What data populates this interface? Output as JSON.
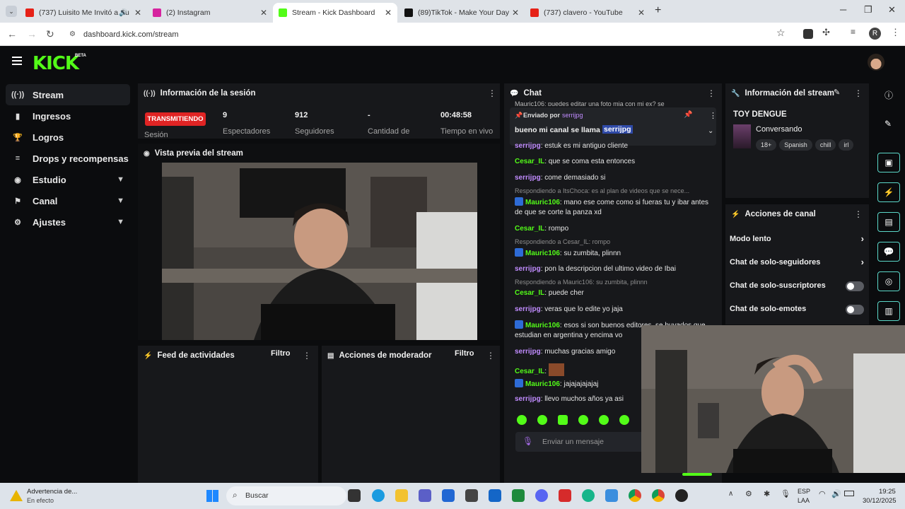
{
  "browser": {
    "tabs": [
      {
        "title": "(737) Luisito Me Invitó a Su",
        "color": "#e62117"
      },
      {
        "title": "(2) Instagram",
        "color": "#d6249f"
      },
      {
        "title": "Stream - Kick Dashboard",
        "color": "#53fc18"
      },
      {
        "title": "(89)TikTok - Make Your Day",
        "color": "#111111"
      },
      {
        "title": "(737) clavero - YouTube",
        "color": "#e62117"
      }
    ],
    "url": "dashboard.kick.com/stream",
    "profile_initial": "R"
  },
  "kick": {
    "logo": "KICK",
    "beta": "BETA"
  },
  "sidebar": {
    "items": [
      {
        "label": "Stream",
        "icon": "broadcast-icon",
        "glyph": "((·))"
      },
      {
        "label": "Ingresos",
        "icon": "chart-icon",
        "glyph": "▮"
      },
      {
        "label": "Logros",
        "icon": "trophy-icon",
        "glyph": "🏆"
      },
      {
        "label": "Drops y recompensas",
        "icon": "drops-icon",
        "glyph": "≡"
      },
      {
        "label": "Estudio",
        "icon": "studio-icon",
        "glyph": "◉"
      },
      {
        "label": "Canal",
        "icon": "channel-icon",
        "glyph": "⚑"
      },
      {
        "label": "Ajustes",
        "icon": "gear-icon",
        "glyph": "⚙"
      }
    ]
  },
  "session": {
    "title": "Información de la sesión",
    "status": "TRANSMITIENDO",
    "status_label": "Sesión",
    "spectators_value": "9",
    "spectators_label": "Espectadores",
    "followers_value": "912",
    "followers_label": "Seguidores",
    "amount_value": "-",
    "amount_label": "Cantidad de",
    "time_value": "00:48:58",
    "time_label": "Tiempo en vivo"
  },
  "preview": {
    "title": "Vista previa del stream"
  },
  "feed": {
    "title": "Feed de actividades",
    "filter": "Filtro"
  },
  "mod": {
    "title": "Acciones de moderador",
    "filter": "Filtro"
  },
  "chat": {
    "title": "Chat",
    "pinned": {
      "sent_by": "Enviado por",
      "user": "serrijpg",
      "text": "bueno mi canal se llama",
      "highlight": "serrijpg"
    },
    "partial_top": "Mauric106: puedes editar una foto mia con mi ex? se",
    "messages": [
      {
        "user": "serrijpg",
        "text": ": estuk es mi antiguo cliente"
      },
      {
        "user": "Cesar_IL",
        "text": ": que se coma esta entonces"
      },
      {
        "user": "serrijpg",
        "text": ": come demasiado si"
      },
      {
        "reply": "Respondiendo a ItsChoca: es al plan de videos que se nece..."
      },
      {
        "user": "Mauric106",
        "text": ": mano ese come como si fueras tu y ibar antes de que se corte la panza xd"
      },
      {
        "user": "Cesar_IL",
        "text": ": rompo"
      },
      {
        "reply": "Respondiendo a Cesar_IL: rompo"
      },
      {
        "user": "Mauric106",
        "text": ": su zumbita, plinnn"
      },
      {
        "user": "serrijpg",
        "text": ": pon la descripcion del ultimo video de Ibai"
      },
      {
        "reply": "Respondiendo a Mauric106: su zumbita, plinnn"
      },
      {
        "user": "Cesar_IL",
        "text": ": puede cher"
      },
      {
        "user": "serrijpg",
        "text": ": veras que lo edite yo jaja"
      },
      {
        "user": "Mauric106",
        "text": ": esos si son buenos editores, se buyados que estudian en argentina y encima vo"
      },
      {
        "user": "serrijpg",
        "text": ": muchas gracias amigo"
      },
      {
        "user": "Cesar_IL",
        "text": ":"
      },
      {
        "user": "Mauric106",
        "text": ": jajajajajajaj"
      },
      {
        "user": "serrijpg",
        "text": ": llevo muchos años ya asi"
      }
    ],
    "placeholder": "Enviar un mensaje"
  },
  "stream_info": {
    "title": "Información del stream",
    "stream_title": "TOY DENGUE",
    "category": "Conversando",
    "tags": [
      "18+",
      "Spanish",
      "chill",
      "irl"
    ]
  },
  "channel_actions": {
    "title": "Acciones de canal",
    "rows": [
      {
        "label": "Modo lento"
      },
      {
        "label": "Chat de solo-seguidores"
      },
      {
        "label": "Chat de solo-suscriptores"
      },
      {
        "label": "Chat de solo-emotes"
      }
    ]
  },
  "taskbar": {
    "weather_title": "Advertencia de...",
    "weather_sub": "En efecto",
    "search": "Buscar",
    "lang_top": "ESP",
    "lang_bottom": "LAA",
    "time": "19:25",
    "date": "30/12/2025"
  }
}
